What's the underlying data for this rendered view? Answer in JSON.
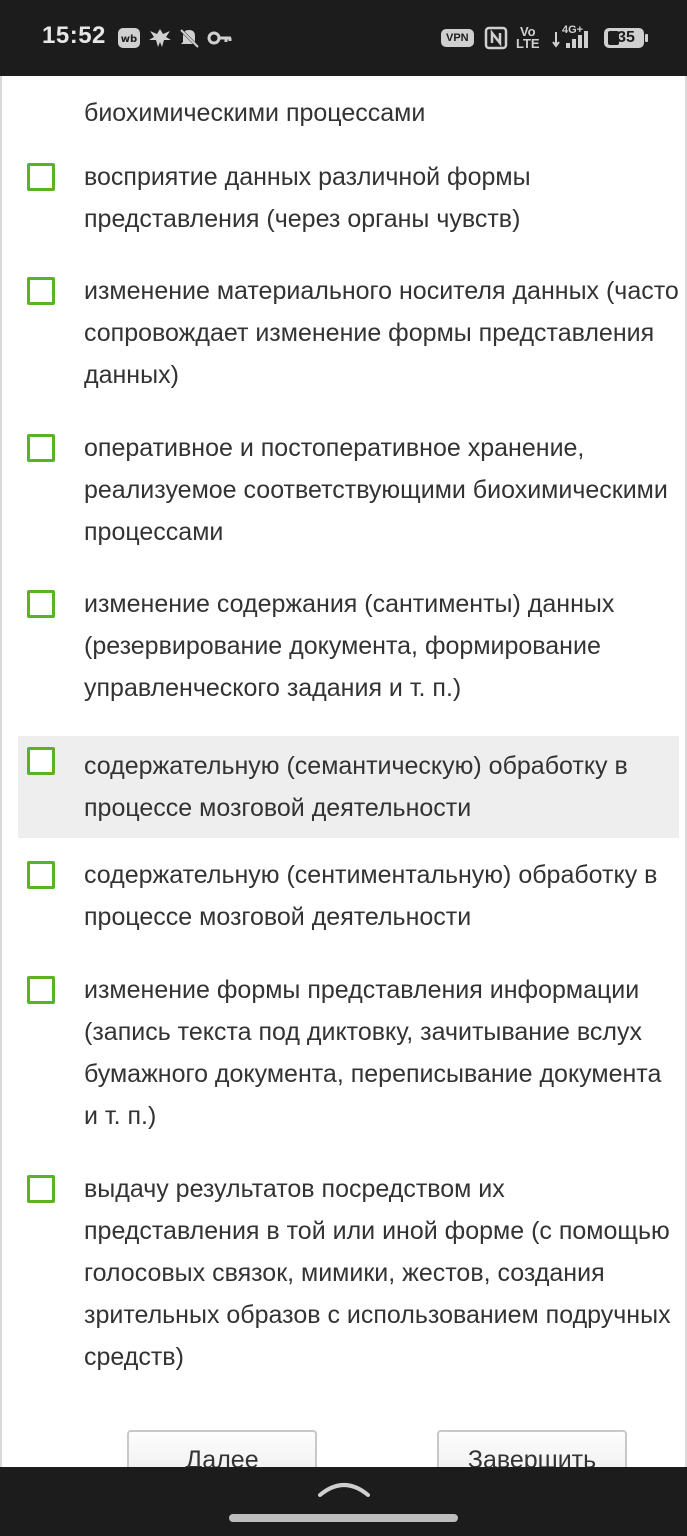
{
  "status_bar": {
    "time": "15:52",
    "left_icons": [
      "wildberries-icon",
      "emblem-icon",
      "muted-bell-icon",
      "key-icon"
    ],
    "vpn_label": "VPN",
    "volte_label_1": "Vo",
    "volte_label_2": "LTE",
    "network_label": "4G+",
    "battery_level": "35"
  },
  "question": {
    "partial_text": "биохимическими процессами",
    "options": [
      {
        "label": "восприятие данных различной формы представления (через органы чувств)",
        "checked": false
      },
      {
        "label": "изменение материального носителя данных (часто сопровождает изменение формы представления данных)",
        "checked": false
      },
      {
        "label": "оперативное и постоперативное хранение, реализуемое соответствующими биохимическими процессами",
        "checked": false
      },
      {
        "label": "изменение содержания (сантименты) данных (резервирование документа, формирование управленческого задания и т. п.)",
        "checked": false
      },
      {
        "label": "содержательную (семантическую) обработку в процессе мозговой деятельности",
        "checked": false,
        "highlighted": true
      },
      {
        "label": "содержательную (сентиментальную) обработку в процессе мозговой деятельности",
        "checked": false
      },
      {
        "label": "изменение формы представления информации (запись текста под диктовку, зачитывание вслух бумажного документа, переписывание документа и т. п.)",
        "checked": false
      },
      {
        "label": "выдачу результатов посредством их представления в той или иной форме (с помощью голосовых связок, мимики, жестов, создания зрительных образов с использованием подручных средств)",
        "checked": false
      }
    ]
  },
  "buttons": {
    "next": "Далее",
    "finish": "Завершить"
  },
  "colors": {
    "checkbox_border": "#5ab324",
    "highlight_bg": "#eeeeee",
    "status_bar_bg": "#1c1c1c"
  }
}
